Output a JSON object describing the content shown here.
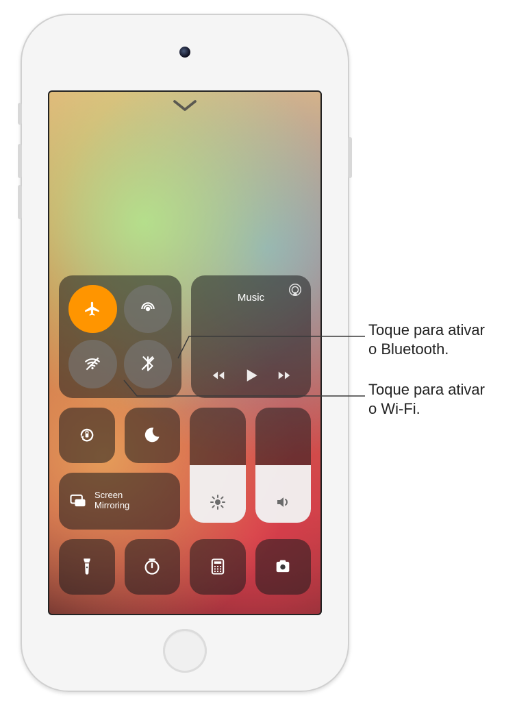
{
  "connectivity": {
    "airplane": {
      "name": "airplane-icon",
      "active": true
    },
    "airdrop": {
      "name": "airdrop-icon",
      "active": false
    },
    "wifi": {
      "name": "wifi-off-icon",
      "active": false
    },
    "bluetooth": {
      "name": "bluetooth-off-icon",
      "active": false
    }
  },
  "music": {
    "title": "Music",
    "airplay_icon": "airplay-icon",
    "prev_icon": "previous-track-icon",
    "play_icon": "play-icon",
    "next_icon": "next-track-icon"
  },
  "toggles": {
    "orientation_lock": "orientation-lock-icon",
    "do_not_disturb": "do-not-disturb-icon"
  },
  "screen_mirroring": {
    "icon": "screen-mirroring-icon",
    "label": "Screen\nMirroring"
  },
  "sliders": {
    "brightness": {
      "icon": "brightness-icon",
      "level_pct": 50
    },
    "volume": {
      "icon": "volume-icon",
      "level_pct": 50
    }
  },
  "shortcuts": {
    "flashlight": "flashlight-icon",
    "timer": "timer-icon",
    "calculator": "calculator-icon",
    "camera": "camera-icon"
  },
  "callouts": {
    "bluetooth": "Toque para ativar\no Bluetooth.",
    "wifi": "Toque para ativar\no Wi-Fi."
  },
  "close_handle_icon": "chevron-down-icon",
  "colors": {
    "active_orange": "#ff9500",
    "tile_bg": "rgba(28,28,30,0.55)"
  }
}
